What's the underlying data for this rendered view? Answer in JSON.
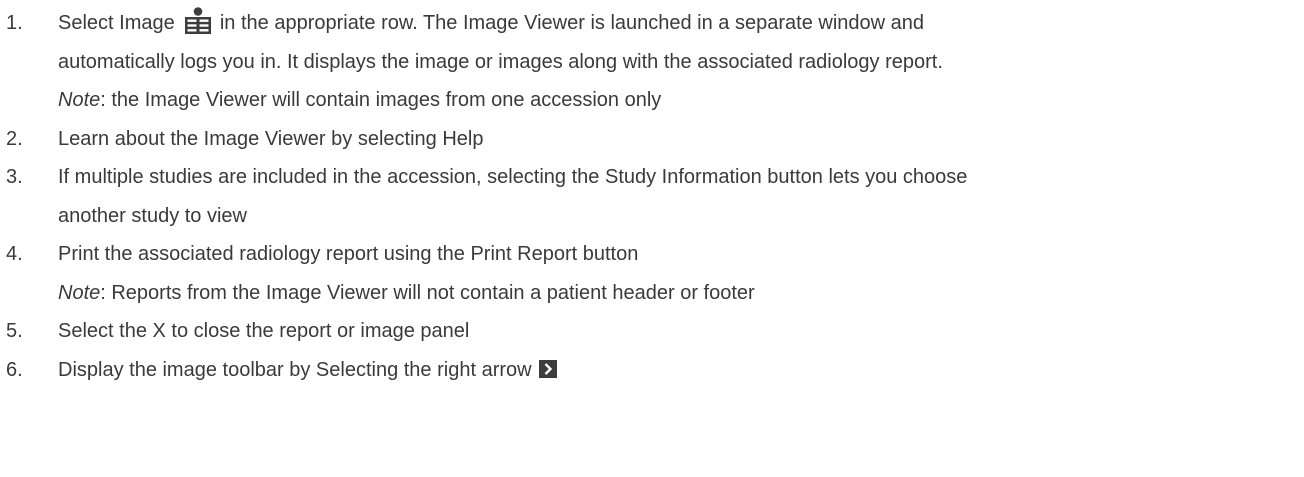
{
  "steps": [
    {
      "number": "1.",
      "part_a": "Select Image ",
      "icon": "image-viewer-icon",
      "part_b": " in the appropriate row.  The Image Viewer is launched in a separate window and",
      "line2": "automatically logs you in.  It displays the image or images along with the associated radiology report.",
      "note_label": "Note",
      "note_text": ": the Image Viewer will contain images from one accession only"
    },
    {
      "number": "2.",
      "text": "Learn about the Image Viewer by selecting Help"
    },
    {
      "number": "3.",
      "line1": "If multiple studies are included in the accession, selecting the Study Information button lets you choose",
      "line2": "another study to view"
    },
    {
      "number": "4.",
      "line1": "Print the associated radiology report using the Print Report button",
      "note_label": "Note",
      "note_text": ": Reports from the Image Viewer will not contain a patient header or footer"
    },
    {
      "number": "5.",
      "text": "Select the X to close the report or image panel"
    },
    {
      "number": "6.",
      "text": "Display the image toolbar by Selecting the right arrow ",
      "icon": "right-arrow-icon"
    }
  ],
  "colors": {
    "text": "#3a3a3a",
    "icon": "#3d3d3d"
  }
}
